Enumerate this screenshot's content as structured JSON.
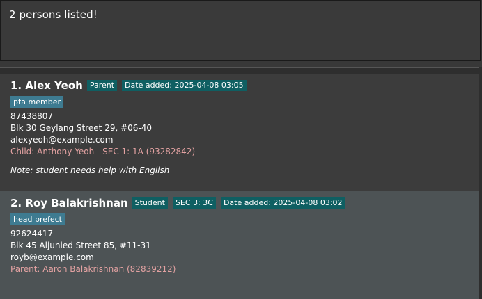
{
  "result": {
    "message": "2 persons listed!"
  },
  "persons": [
    {
      "index_name": "1. Alex Yeoh",
      "role": "Parent",
      "date_added": "Date added: 2025-04-08 03:05",
      "tag": "pta member",
      "phone": "87438807",
      "address": "Blk 30 Geylang Street 29, #06-40",
      "email": "alexyeoh@example.com",
      "relation": "Child: Anthony Yeoh - SEC 1: 1A (93282842)",
      "note": "Note: student needs help with English"
    },
    {
      "index_name": "2. Roy Balakrishnan",
      "role": "Student",
      "class": "SEC 3: 3C",
      "date_added": "Date added: 2025-04-08 03:02",
      "tag": "head prefect",
      "phone": "92624417",
      "address": "Blk 45 Aljunied Street 85, #11-31",
      "email": "royb@example.com",
      "relation": "Parent: Aaron Balakrishnan (82839212)"
    }
  ]
}
